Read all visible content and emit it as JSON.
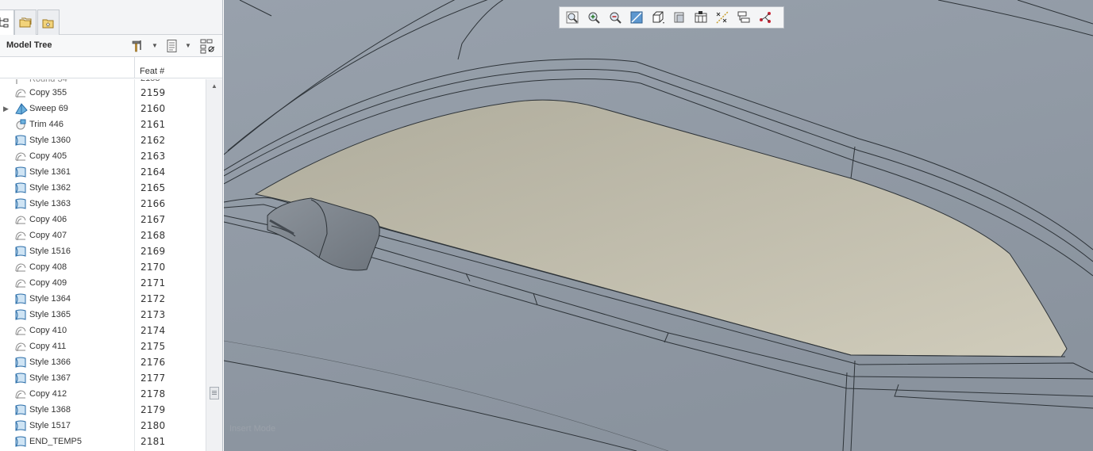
{
  "panel": {
    "title": "Model Tree",
    "column_header": "Feat #"
  },
  "tree": {
    "rows": [
      {
        "name": "Copy 355",
        "num": "2159",
        "type": "copy"
      },
      {
        "name": "Sweep 69",
        "num": "2160",
        "type": "sweep",
        "expandable": true
      },
      {
        "name": "Trim 446",
        "num": "2161",
        "type": "trim"
      },
      {
        "name": "Style 1360",
        "num": "2162",
        "type": "style"
      },
      {
        "name": "Copy 405",
        "num": "2163",
        "type": "copy"
      },
      {
        "name": "Style 1361",
        "num": "2164",
        "type": "style"
      },
      {
        "name": "Style 1362",
        "num": "2165",
        "type": "style"
      },
      {
        "name": "Style 1363",
        "num": "2166",
        "type": "style"
      },
      {
        "name": "Copy 406",
        "num": "2167",
        "type": "copy"
      },
      {
        "name": "Copy 407",
        "num": "2168",
        "type": "copy"
      },
      {
        "name": "Style 1516",
        "num": "2169",
        "type": "style"
      },
      {
        "name": "Copy 408",
        "num": "2170",
        "type": "copy"
      },
      {
        "name": "Copy 409",
        "num": "2171",
        "type": "copy"
      },
      {
        "name": "Style 1364",
        "num": "2172",
        "type": "style"
      },
      {
        "name": "Style 1365",
        "num": "2173",
        "type": "style"
      },
      {
        "name": "Copy 410",
        "num": "2174",
        "type": "copy"
      },
      {
        "name": "Copy 411",
        "num": "2175",
        "type": "copy"
      },
      {
        "name": "Style 1366",
        "num": "2176",
        "type": "style"
      },
      {
        "name": "Style 1367",
        "num": "2177",
        "type": "style"
      },
      {
        "name": "Copy 412",
        "num": "2178",
        "type": "copy"
      },
      {
        "name": "Style 1368",
        "num": "2179",
        "type": "style"
      },
      {
        "name": "Style 1517",
        "num": "2180",
        "type": "style"
      },
      {
        "name": "END_TEMP5",
        "num": "2181",
        "type": "style"
      }
    ]
  },
  "viewport": {
    "mode_label": "Insert Mode",
    "toolbar_icons": [
      "refit-icon",
      "zoom-in-icon",
      "zoom-out-icon",
      "repaint-icon",
      "saved-orientations-icon",
      "display-style-icon",
      "view-manager-icon",
      "datum-display-icon",
      "spin-center-icon",
      "annotation-display-icon"
    ]
  },
  "colors": {
    "surface_tan": "#b9b6a6",
    "body_gray": "#8f98a3",
    "toolbar_bg": "#f4f5f6"
  }
}
